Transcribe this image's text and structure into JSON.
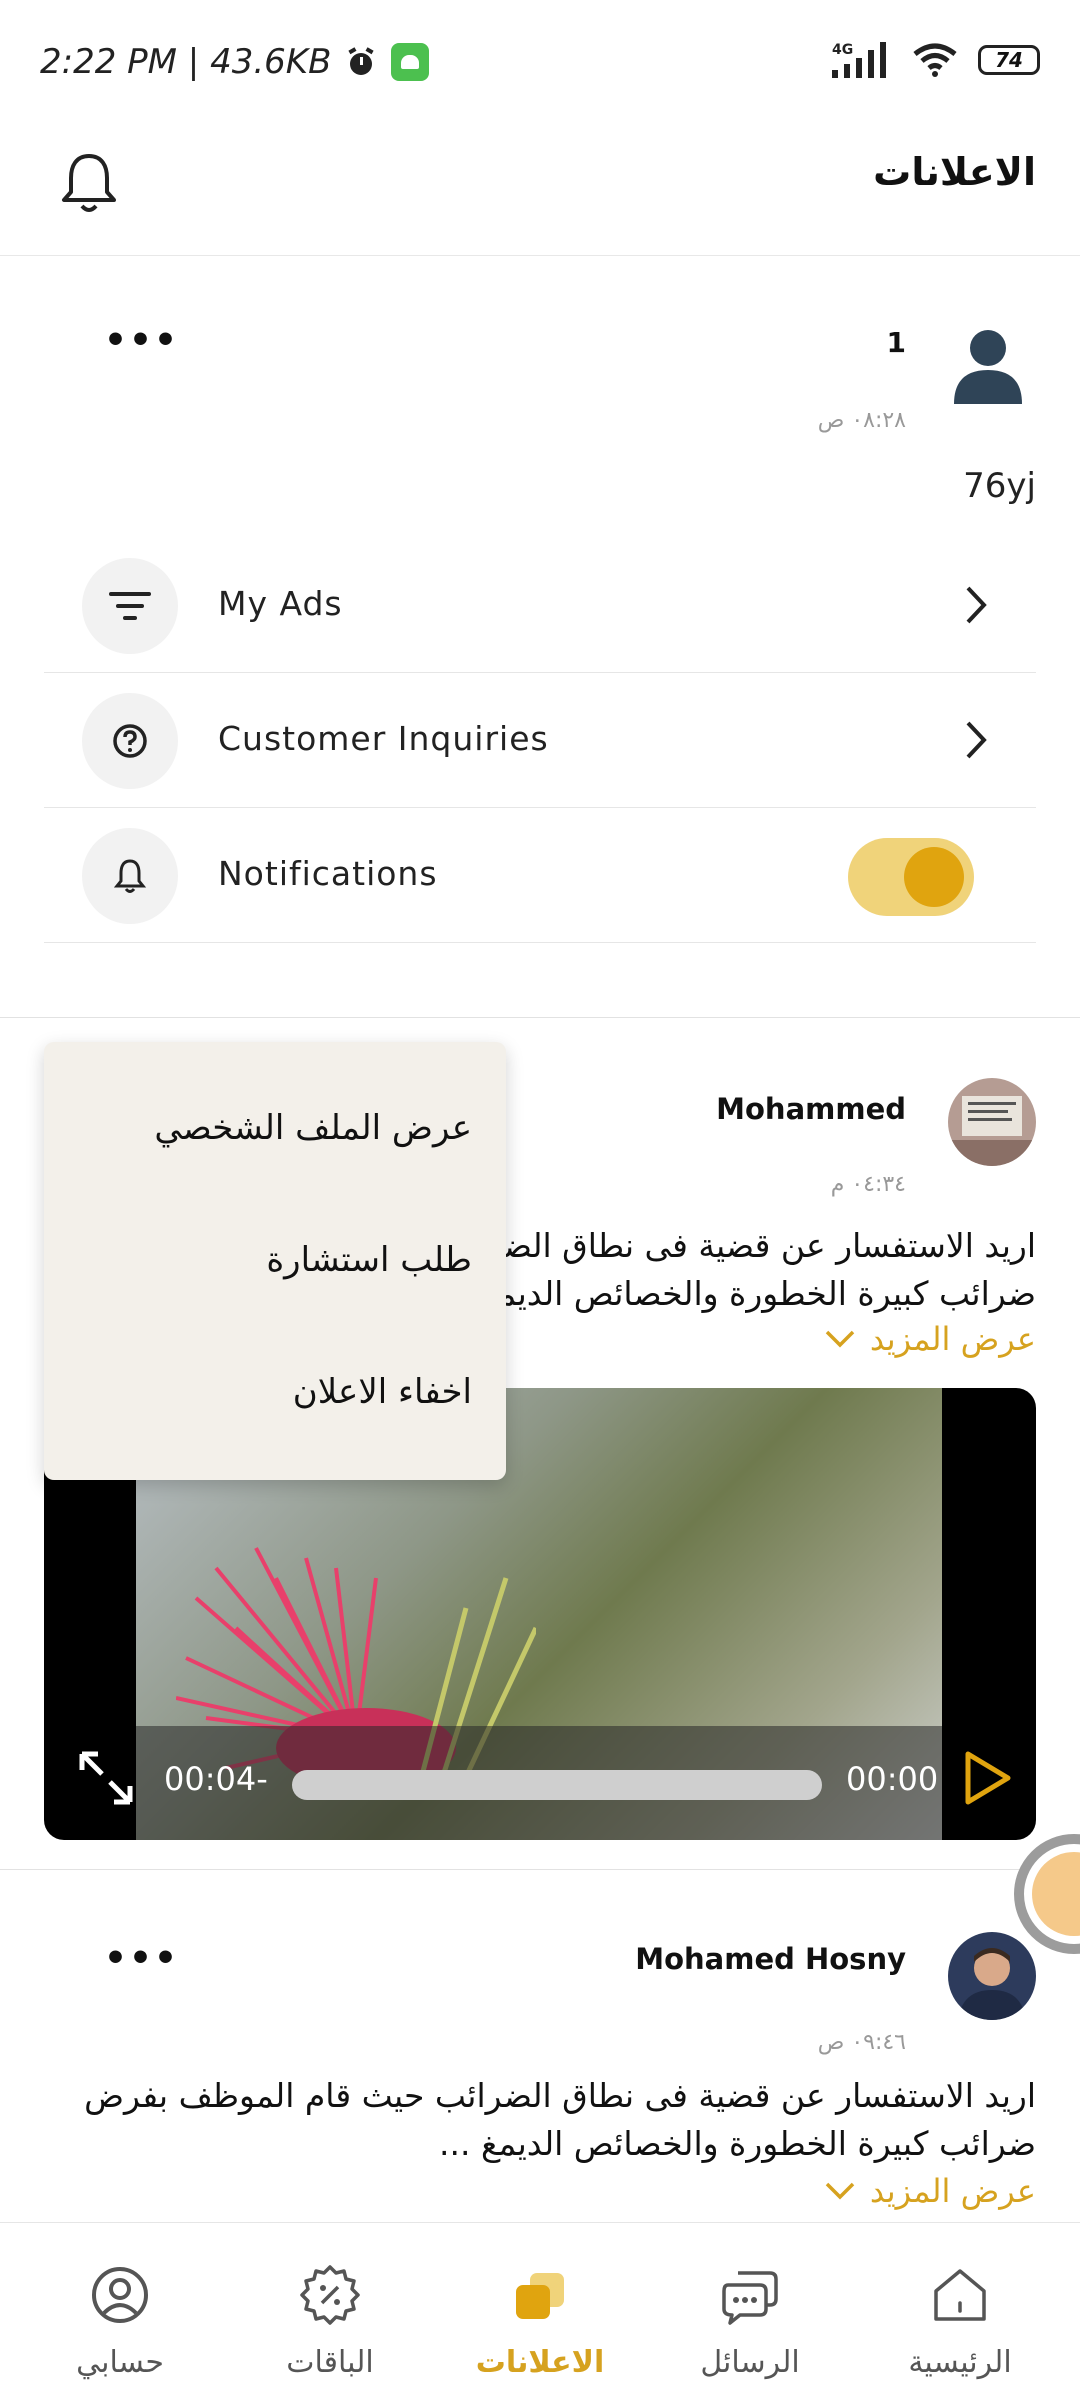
{
  "status_bar": {
    "time_speed": "2:22 PM | 43.6KB",
    "network": "4G",
    "battery": "74"
  },
  "header": {
    "title": "الاعلانات"
  },
  "profile_card": {
    "name": "1",
    "time": "٠٨:٢٨ ص",
    "text": "76yj",
    "menu": [
      {
        "label": "My Ads",
        "icon": "filter-icon"
      },
      {
        "label": "Customer Inquiries",
        "icon": "question-icon"
      },
      {
        "label": "Notifications",
        "icon": "bell-icon",
        "toggle_on": true
      }
    ]
  },
  "posts": [
    {
      "name": "Mohammed",
      "time": "٠٤:٣٤ م",
      "line1": "اريد الاستفسار عن قضية فى نطاق الضرائب حيث قام الموظف بفرض",
      "line2": "ضرائب كبيرة  الخطورة والخصائص الديمغ ...",
      "more": "عرض المزيد",
      "video": {
        "remaining": "00:04-",
        "elapsed": "00:00"
      }
    },
    {
      "name": "Mohamed Hosny",
      "time": "٠٩:٤٦ ص",
      "line1": "اريد الاستفسار عن قضية فى نطاق الضرائب حيث قام الموظف بفرض",
      "line2": "ضرائب كبيرة  الخطورة والخصائص الديمغ ...",
      "more": "عرض المزيد"
    }
  ],
  "popup_menu": {
    "items": [
      "عرض الملف الشخصي",
      "طلب استشارة",
      "اخفاء الاعلان"
    ]
  },
  "bottom_nav": {
    "items": [
      {
        "label": "حسابي",
        "icon": "user-icon"
      },
      {
        "label": "الباقات",
        "icon": "discount-icon"
      },
      {
        "label": "الاعلانات",
        "icon": "ads-icon",
        "active": true
      },
      {
        "label": "الرسائل",
        "icon": "chat-icon"
      },
      {
        "label": "الرئيسية",
        "icon": "home-icon"
      }
    ]
  },
  "colors": {
    "accent": "#d6a21f",
    "toggle_track": "#f0d37a",
    "toggle_knob": "#e0a40f"
  }
}
